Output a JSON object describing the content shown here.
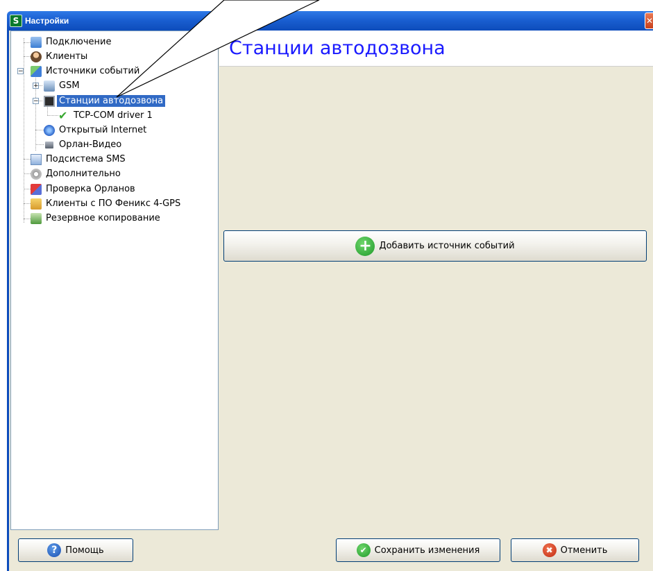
{
  "window": {
    "title": "Настройки",
    "app_icon_letter": "S",
    "close_glyph": "✕"
  },
  "tree": {
    "items": [
      {
        "label": "Подключение",
        "icon": "connection-icon"
      },
      {
        "label": "Клиенты",
        "icon": "clients-icon"
      },
      {
        "label": "Источники событий",
        "icon": "event-sources-icon",
        "expanded": true
      },
      {
        "label": "GSM",
        "icon": "gsm-icon",
        "expanded": false
      },
      {
        "label": "Станции автодозвона",
        "icon": "autodial-station-icon",
        "expanded": true,
        "selected": true
      },
      {
        "label": "TCP-COM driver 1",
        "icon": "check-icon"
      },
      {
        "label": "Открытый Internet",
        "icon": "internet-icon"
      },
      {
        "label": "Орлан-Видео",
        "icon": "video-camera-icon"
      },
      {
        "label": "Подсистема SMS",
        "icon": "sms-icon"
      },
      {
        "label": "Дополнительно",
        "icon": "gear-icon"
      },
      {
        "label": "Проверка Орланов",
        "icon": "checklist-icon"
      },
      {
        "label": "Клиенты с ПО Феникс 4-GPS",
        "icon": "gps-clients-icon"
      },
      {
        "label": "Резервное копирование",
        "icon": "backup-icon"
      }
    ]
  },
  "content": {
    "title": "Станции автодозвона",
    "add_button_label": "Добавить источник событий",
    "add_icon_glyph": "+"
  },
  "footer": {
    "help_label": "Помощь",
    "help_icon_glyph": "?",
    "save_label": "Сохранить изменения",
    "save_icon_glyph": "✔",
    "cancel_label": "Отменить",
    "cancel_icon_glyph": "✖"
  },
  "colors": {
    "accent_title": "#1a1aff",
    "selection": "#316ac5",
    "titlebar": "#1a5fd1"
  }
}
